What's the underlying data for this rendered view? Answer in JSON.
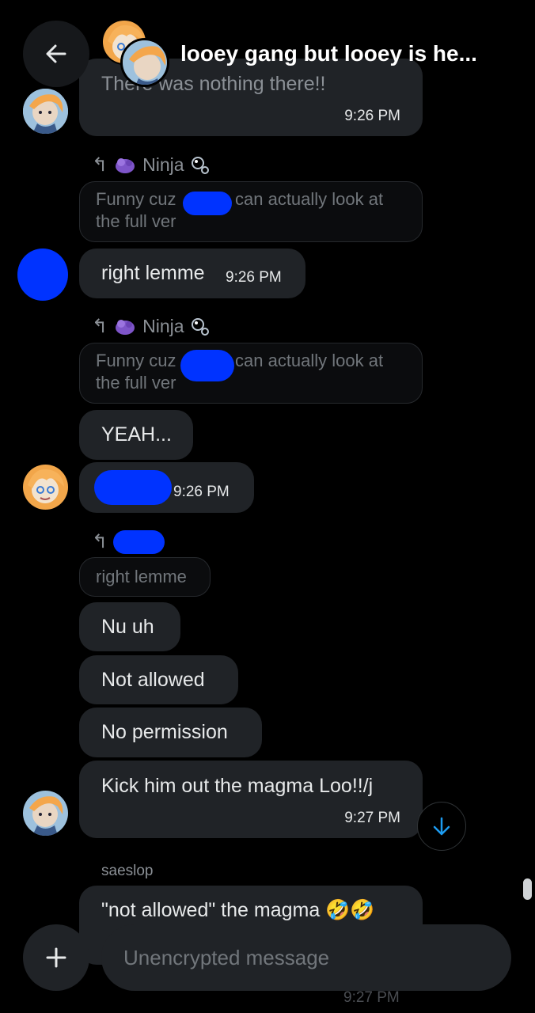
{
  "header": {
    "title": "looey gang but looey is he..."
  },
  "messages": {
    "m1_text": "There was nothing there!!",
    "m1_time": "9:26 PM",
    "r1_name": "Ninja",
    "q1_pre": "Funny cuz",
    "q1_post": "can actually look at",
    "q1_line2": "the full ver",
    "m2_text": "right lemme",
    "m2_time": "9:26 PM",
    "r2_name": "Ninja",
    "q2_pre": "Funny cuz",
    "q2_post": "can actually look at",
    "q2_line2": "the full ver",
    "m3_text": "YEAH...",
    "m4_time": "9:26 PM",
    "q3_text": "right lemme",
    "m5_text": "Nu uh",
    "m6_text": "Not allowed",
    "m7_text": "No permission",
    "m8_text": "Kick him out the magma Loo!!/j",
    "m8_time": "9:27 PM",
    "sender_name": "saeslop",
    "m9_text": "\"not allowed\" the magma 🤣🤣",
    "m10_time": "9:27 PM"
  },
  "composer": {
    "placeholder": "Unencrypted message"
  },
  "icons": {
    "back": "arrow-left-icon",
    "reply": "reply-arrow-icon",
    "scroll_down": "arrow-down-icon",
    "add": "plus-icon"
  },
  "colors": {
    "accent": "#1d9bf0",
    "bubble": "#202327",
    "redaction": "#0033ff"
  }
}
